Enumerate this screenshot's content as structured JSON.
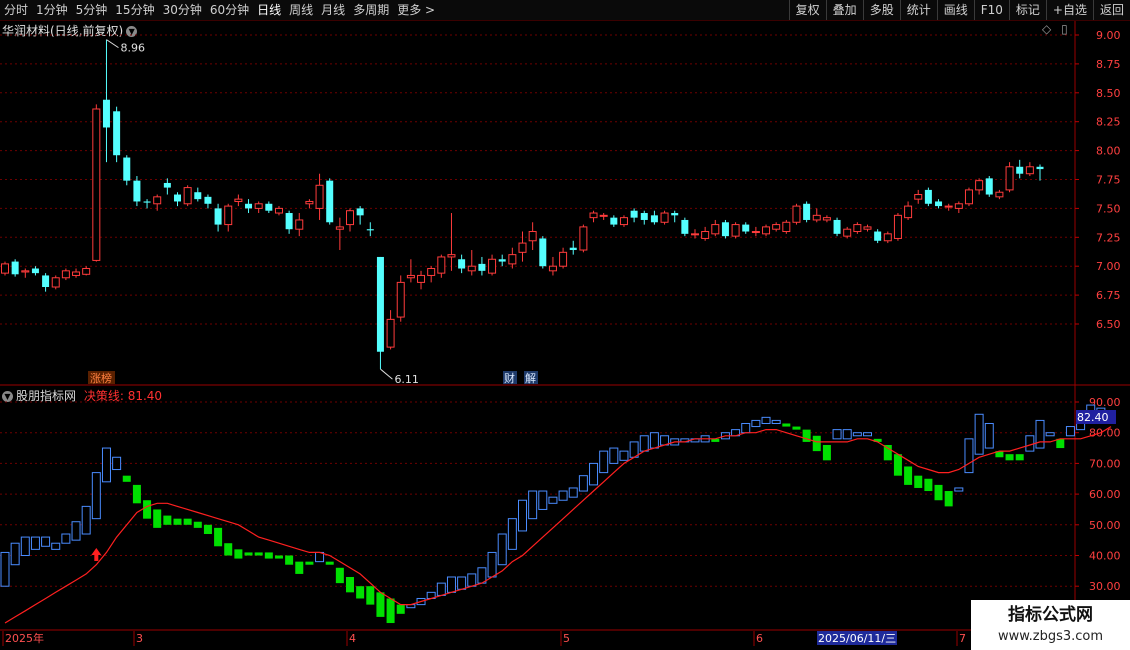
{
  "toolbar": {
    "left": [
      "分时",
      "1分钟",
      "5分钟",
      "15分钟",
      "30分钟",
      "60分钟",
      "日线",
      "周线",
      "月线",
      "多周期",
      "更多 >"
    ],
    "active_index": 6,
    "right": [
      "复权",
      "叠加",
      "多股",
      "统计",
      "画线",
      "F10",
      "标记",
      "+自选",
      "返回"
    ]
  },
  "main_panel": {
    "title": "华润材料(日线,前复权)",
    "price_axis": [
      "9.00",
      "8.75",
      "8.50",
      "8.25",
      "8.00",
      "7.75",
      "7.50",
      "7.25",
      "7.00",
      "6.75",
      "6.50"
    ],
    "high_label": "8.96",
    "low_label": "6.11",
    "tag_zhangbang": "涨榜",
    "tag_cai": "财",
    "tag_jie": "解"
  },
  "indicator_panel": {
    "name": "股朋指标网",
    "line_label": "决策线: 81.40",
    "current_value": "82.40",
    "axis": [
      "90.00",
      "80.00",
      "70.00",
      "60.00",
      "50.00",
      "40.00",
      "30.00"
    ]
  },
  "date_axis": {
    "labels": [
      "2025年",
      "3",
      "4",
      "5",
      "6",
      "7"
    ],
    "cursor_date": "2025/06/11/三"
  },
  "watermark": {
    "line1": "指标公式网",
    "line2": "www.zbgs3.com"
  },
  "colors": {
    "up": "#ff3c3c",
    "down": "#54ffff",
    "grid": "#6e0000",
    "decision_line": "#ff2020",
    "ind_up": "#4a8cff",
    "ind_down": "#00e000"
  },
  "chart_data": [
    {
      "type": "candlestick",
      "y_range": [
        6.1,
        9.0
      ],
      "bars": [
        {
          "o": 6.94,
          "c": 7.02,
          "h": 7.04,
          "l": 6.92
        },
        {
          "o": 7.04,
          "c": 6.93,
          "h": 7.06,
          "l": 6.91
        },
        {
          "o": 6.95,
          "c": 6.96,
          "h": 6.98,
          "l": 6.9
        },
        {
          "o": 6.98,
          "c": 6.94,
          "h": 7.0,
          "l": 6.92
        },
        {
          "o": 6.92,
          "c": 6.82,
          "h": 6.94,
          "l": 6.78
        },
        {
          "o": 6.82,
          "c": 6.9,
          "h": 6.92,
          "l": 6.8
        },
        {
          "o": 6.9,
          "c": 6.96,
          "h": 6.98,
          "l": 6.88
        },
        {
          "o": 6.92,
          "c": 6.95,
          "h": 6.98,
          "l": 6.9
        },
        {
          "o": 6.93,
          "c": 6.98,
          "h": 7.0,
          "l": 6.92
        },
        {
          "o": 7.05,
          "c": 8.36,
          "h": 8.4,
          "l": 7.04
        },
        {
          "o": 8.44,
          "c": 8.2,
          "h": 8.96,
          "l": 7.9
        },
        {
          "o": 8.34,
          "c": 7.96,
          "h": 8.38,
          "l": 7.9
        },
        {
          "o": 7.94,
          "c": 7.74,
          "h": 7.96,
          "l": 7.7
        },
        {
          "o": 7.74,
          "c": 7.56,
          "h": 7.78,
          "l": 7.52
        },
        {
          "o": 7.56,
          "c": 7.55,
          "h": 7.58,
          "l": 7.5
        },
        {
          "o": 7.54,
          "c": 7.6,
          "h": 7.62,
          "l": 7.48
        },
        {
          "o": 7.72,
          "c": 7.68,
          "h": 7.76,
          "l": 7.62
        },
        {
          "o": 7.62,
          "c": 7.56,
          "h": 7.64,
          "l": 7.52
        },
        {
          "o": 7.54,
          "c": 7.68,
          "h": 7.7,
          "l": 7.52
        },
        {
          "o": 7.64,
          "c": 7.58,
          "h": 7.68,
          "l": 7.56
        },
        {
          "o": 7.6,
          "c": 7.54,
          "h": 7.62,
          "l": 7.5
        },
        {
          "o": 7.5,
          "c": 7.36,
          "h": 7.54,
          "l": 7.3
        },
        {
          "o": 7.36,
          "c": 7.52,
          "h": 7.54,
          "l": 7.3
        },
        {
          "o": 7.56,
          "c": 7.58,
          "h": 7.62,
          "l": 7.52
        },
        {
          "o": 7.54,
          "c": 7.5,
          "h": 7.58,
          "l": 7.46
        },
        {
          "o": 7.5,
          "c": 7.54,
          "h": 7.56,
          "l": 7.46
        },
        {
          "o": 7.54,
          "c": 7.48,
          "h": 7.56,
          "l": 7.46
        },
        {
          "o": 7.46,
          "c": 7.5,
          "h": 7.52,
          "l": 7.44
        },
        {
          "o": 7.46,
          "c": 7.32,
          "h": 7.48,
          "l": 7.28
        },
        {
          "o": 7.32,
          "c": 7.4,
          "h": 7.46,
          "l": 7.26
        },
        {
          "o": 7.54,
          "c": 7.56,
          "h": 7.58,
          "l": 7.5
        },
        {
          "o": 7.5,
          "c": 7.7,
          "h": 7.8,
          "l": 7.4
        },
        {
          "o": 7.74,
          "c": 7.38,
          "h": 7.76,
          "l": 7.36
        },
        {
          "o": 7.32,
          "c": 7.34,
          "h": 7.42,
          "l": 7.14
        },
        {
          "o": 7.36,
          "c": 7.48,
          "h": 7.5,
          "l": 7.3
        },
        {
          "o": 7.5,
          "c": 7.44,
          "h": 7.52,
          "l": 7.36
        },
        {
          "o": 7.32,
          "c": 7.31,
          "h": 7.38,
          "l": 7.26
        },
        {
          "o": 7.08,
          "c": 6.26,
          "h": 7.08,
          "l": 6.11
        },
        {
          "o": 6.3,
          "c": 6.54,
          "h": 6.62,
          "l": 6.28
        },
        {
          "o": 6.56,
          "c": 6.86,
          "h": 6.92,
          "l": 6.52
        },
        {
          "o": 6.9,
          "c": 6.92,
          "h": 7.06,
          "l": 6.86
        },
        {
          "o": 6.86,
          "c": 6.92,
          "h": 6.96,
          "l": 6.8
        },
        {
          "o": 6.92,
          "c": 6.98,
          "h": 7.0,
          "l": 6.86
        },
        {
          "o": 6.94,
          "c": 7.08,
          "h": 7.1,
          "l": 6.9
        },
        {
          "o": 7.08,
          "c": 7.1,
          "h": 7.46,
          "l": 6.96
        },
        {
          "o": 7.06,
          "c": 6.98,
          "h": 7.1,
          "l": 6.94
        },
        {
          "o": 6.96,
          "c": 7.0,
          "h": 7.14,
          "l": 6.92
        },
        {
          "o": 7.02,
          "c": 6.96,
          "h": 7.08,
          "l": 6.92
        },
        {
          "o": 6.94,
          "c": 7.06,
          "h": 7.1,
          "l": 6.92
        },
        {
          "o": 7.06,
          "c": 7.04,
          "h": 7.1,
          "l": 7.0
        },
        {
          "o": 7.02,
          "c": 7.1,
          "h": 7.16,
          "l": 6.98
        },
        {
          "o": 7.12,
          "c": 7.2,
          "h": 7.3,
          "l": 7.04
        },
        {
          "o": 7.22,
          "c": 7.3,
          "h": 7.38,
          "l": 7.14
        },
        {
          "o": 7.24,
          "c": 7.0,
          "h": 7.26,
          "l": 6.98
        },
        {
          "o": 6.96,
          "c": 7.0,
          "h": 7.08,
          "l": 6.92
        },
        {
          "o": 7.0,
          "c": 7.12,
          "h": 7.16,
          "l": 6.98
        },
        {
          "o": 7.16,
          "c": 7.14,
          "h": 7.22,
          "l": 7.1
        },
        {
          "o": 7.14,
          "c": 7.34,
          "h": 7.36,
          "l": 7.12
        },
        {
          "o": 7.42,
          "c": 7.46,
          "h": 7.48,
          "l": 7.38
        },
        {
          "o": 7.44,
          "c": 7.44,
          "h": 7.46,
          "l": 7.4
        },
        {
          "o": 7.42,
          "c": 7.36,
          "h": 7.44,
          "l": 7.34
        },
        {
          "o": 7.36,
          "c": 7.42,
          "h": 7.44,
          "l": 7.34
        },
        {
          "o": 7.48,
          "c": 7.42,
          "h": 7.5,
          "l": 7.38
        },
        {
          "o": 7.46,
          "c": 7.4,
          "h": 7.48,
          "l": 7.36
        },
        {
          "o": 7.44,
          "c": 7.38,
          "h": 7.48,
          "l": 7.36
        },
        {
          "o": 7.38,
          "c": 7.46,
          "h": 7.48,
          "l": 7.36
        },
        {
          "o": 7.46,
          "c": 7.44,
          "h": 7.48,
          "l": 7.38
        },
        {
          "o": 7.4,
          "c": 7.28,
          "h": 7.42,
          "l": 7.26
        },
        {
          "o": 7.28,
          "c": 7.28,
          "h": 7.32,
          "l": 7.24
        },
        {
          "o": 7.24,
          "c": 7.3,
          "h": 7.34,
          "l": 7.22
        },
        {
          "o": 7.28,
          "c": 7.36,
          "h": 7.4,
          "l": 7.26
        },
        {
          "o": 7.38,
          "c": 7.26,
          "h": 7.4,
          "l": 7.24
        },
        {
          "o": 7.26,
          "c": 7.36,
          "h": 7.38,
          "l": 7.24
        },
        {
          "o": 7.36,
          "c": 7.3,
          "h": 7.38,
          "l": 7.28
        },
        {
          "o": 7.3,
          "c": 7.3,
          "h": 7.34,
          "l": 7.26
        },
        {
          "o": 7.28,
          "c": 7.34,
          "h": 7.36,
          "l": 7.26
        },
        {
          "o": 7.32,
          "c": 7.36,
          "h": 7.38,
          "l": 7.3
        },
        {
          "o": 7.3,
          "c": 7.38,
          "h": 7.4,
          "l": 7.28
        },
        {
          "o": 7.38,
          "c": 7.52,
          "h": 7.54,
          "l": 7.36
        },
        {
          "o": 7.54,
          "c": 7.4,
          "h": 7.56,
          "l": 7.38
        },
        {
          "o": 7.4,
          "c": 7.44,
          "h": 7.5,
          "l": 7.38
        },
        {
          "o": 7.4,
          "c": 7.42,
          "h": 7.44,
          "l": 7.38
        },
        {
          "o": 7.4,
          "c": 7.28,
          "h": 7.42,
          "l": 7.26
        },
        {
          "o": 7.26,
          "c": 7.32,
          "h": 7.34,
          "l": 7.24
        },
        {
          "o": 7.3,
          "c": 7.36,
          "h": 7.38,
          "l": 7.28
        },
        {
          "o": 7.32,
          "c": 7.34,
          "h": 7.36,
          "l": 7.3
        },
        {
          "o": 7.3,
          "c": 7.22,
          "h": 7.32,
          "l": 7.2
        },
        {
          "o": 7.22,
          "c": 7.28,
          "h": 7.3,
          "l": 7.2
        },
        {
          "o": 7.24,
          "c": 7.44,
          "h": 7.46,
          "l": 7.22
        },
        {
          "o": 7.42,
          "c": 7.52,
          "h": 7.56,
          "l": 7.4
        },
        {
          "o": 7.58,
          "c": 7.62,
          "h": 7.66,
          "l": 7.54
        },
        {
          "o": 7.66,
          "c": 7.54,
          "h": 7.68,
          "l": 7.52
        },
        {
          "o": 7.56,
          "c": 7.52,
          "h": 7.58,
          "l": 7.5
        },
        {
          "o": 7.52,
          "c": 7.52,
          "h": 7.54,
          "l": 7.48
        },
        {
          "o": 7.5,
          "c": 7.54,
          "h": 7.56,
          "l": 7.46
        },
        {
          "o": 7.54,
          "c": 7.66,
          "h": 7.68,
          "l": 7.52
        },
        {
          "o": 7.66,
          "c": 7.74,
          "h": 7.76,
          "l": 7.62
        },
        {
          "o": 7.76,
          "c": 7.62,
          "h": 7.78,
          "l": 7.6
        },
        {
          "o": 7.6,
          "c": 7.64,
          "h": 7.66,
          "l": 7.58
        },
        {
          "o": 7.66,
          "c": 7.86,
          "h": 7.9,
          "l": 7.64
        },
        {
          "o": 7.86,
          "c": 7.8,
          "h": 7.92,
          "l": 7.76
        },
        {
          "o": 7.8,
          "c": 7.86,
          "h": 7.9,
          "l": 7.78
        },
        {
          "o": 7.86,
          "c": 7.84,
          "h": 7.88,
          "l": 7.74
        }
      ]
    },
    {
      "type": "indicator",
      "y_range": [
        25,
        93
      ],
      "bars": [
        {
          "o": 30,
          "c": 41
        },
        {
          "o": 37,
          "c": 44
        },
        {
          "o": 40,
          "c": 46
        },
        {
          "o": 42,
          "c": 46
        },
        {
          "o": 43,
          "c": 46
        },
        {
          "o": 42,
          "c": 44
        },
        {
          "o": 44,
          "c": 47
        },
        {
          "o": 45,
          "c": 51
        },
        {
          "o": 47,
          "c": 56
        },
        {
          "o": 52,
          "c": 67
        },
        {
          "o": 64,
          "c": 75
        },
        {
          "o": 68,
          "c": 72
        },
        {
          "o": 66,
          "c": 64
        },
        {
          "o": 63,
          "c": 57
        },
        {
          "o": 58,
          "c": 52
        },
        {
          "o": 55,
          "c": 49
        },
        {
          "o": 53,
          "c": 50
        },
        {
          "o": 52,
          "c": 50
        },
        {
          "o": 52,
          "c": 50
        },
        {
          "o": 51,
          "c": 49
        },
        {
          "o": 50,
          "c": 47
        },
        {
          "o": 49,
          "c": 43
        },
        {
          "o": 44,
          "c": 40
        },
        {
          "o": 42,
          "c": 39
        },
        {
          "o": 41,
          "c": 40
        },
        {
          "o": 41,
          "c": 40
        },
        {
          "o": 41,
          "c": 39
        },
        {
          "o": 40,
          "c": 39
        },
        {
          "o": 40,
          "c": 37
        },
        {
          "o": 38,
          "c": 34
        },
        {
          "o": 38,
          "c": 37
        },
        {
          "o": 38,
          "c": 41
        },
        {
          "o": 38,
          "c": 37
        },
        {
          "o": 36,
          "c": 31
        },
        {
          "o": 33,
          "c": 28
        },
        {
          "o": 30,
          "c": 26
        },
        {
          "o": 30,
          "c": 24
        },
        {
          "o": 28,
          "c": 20
        },
        {
          "o": 26,
          "c": 18
        },
        {
          "o": 24,
          "c": 21
        },
        {
          "o": 23,
          "c": 24
        },
        {
          "o": 24,
          "c": 26
        },
        {
          "o": 26,
          "c": 28
        },
        {
          "o": 27,
          "c": 31
        },
        {
          "o": 28,
          "c": 33
        },
        {
          "o": 29,
          "c": 33
        },
        {
          "o": 30,
          "c": 34
        },
        {
          "o": 31,
          "c": 36
        },
        {
          "o": 33,
          "c": 41
        },
        {
          "o": 37,
          "c": 47
        },
        {
          "o": 42,
          "c": 52
        },
        {
          "o": 48,
          "c": 58
        },
        {
          "o": 52,
          "c": 61
        },
        {
          "o": 55,
          "c": 61
        },
        {
          "o": 57,
          "c": 59
        },
        {
          "o": 58,
          "c": 61
        },
        {
          "o": 59,
          "c": 62
        },
        {
          "o": 61,
          "c": 66
        },
        {
          "o": 63,
          "c": 70
        },
        {
          "o": 67,
          "c": 74
        },
        {
          "o": 70,
          "c": 75
        },
        {
          "o": 71,
          "c": 74
        },
        {
          "o": 72,
          "c": 77
        },
        {
          "o": 74,
          "c": 79
        },
        {
          "o": 75,
          "c": 80
        },
        {
          "o": 76,
          "c": 79
        },
        {
          "o": 76,
          "c": 78
        },
        {
          "o": 77,
          "c": 78
        },
        {
          "o": 77,
          "c": 78
        },
        {
          "o": 77,
          "c": 79
        },
        {
          "o": 78,
          "c": 77
        },
        {
          "o": 78,
          "c": 80
        },
        {
          "o": 79,
          "c": 81
        },
        {
          "o": 80,
          "c": 83
        },
        {
          "o": 82,
          "c": 84
        },
        {
          "o": 83,
          "c": 85
        },
        {
          "o": 83,
          "c": 84
        },
        {
          "o": 83,
          "c": 82
        },
        {
          "o": 82,
          "c": 81
        },
        {
          "o": 81,
          "c": 77
        },
        {
          "o": 79,
          "c": 74
        },
        {
          "o": 76,
          "c": 71
        },
        {
          "o": 78,
          "c": 81
        },
        {
          "o": 78,
          "c": 81
        },
        {
          "o": 79,
          "c": 80
        },
        {
          "o": 79,
          "c": 80
        },
        {
          "o": 78,
          "c": 77
        },
        {
          "o": 76,
          "c": 71
        },
        {
          "o": 73,
          "c": 66
        },
        {
          "o": 69,
          "c": 63
        },
        {
          "o": 66,
          "c": 62
        },
        {
          "o": 65,
          "c": 61
        },
        {
          "o": 63,
          "c": 58
        },
        {
          "o": 61,
          "c": 56
        },
        {
          "o": 61,
          "c": 62
        },
        {
          "o": 67,
          "c": 78
        },
        {
          "o": 73,
          "c": 86
        },
        {
          "o": 75,
          "c": 83
        },
        {
          "o": 74,
          "c": 72
        },
        {
          "o": 73,
          "c": 71
        },
        {
          "o": 73,
          "c": 71
        },
        {
          "o": 74,
          "c": 79
        },
        {
          "o": 75,
          "c": 84
        },
        {
          "o": 79,
          "c": 80
        },
        {
          "o": 78,
          "c": 75
        },
        {
          "o": 79,
          "c": 82
        },
        {
          "o": 81,
          "c": 86
        },
        {
          "o": 84,
          "c": 89
        },
        {
          "o": 86,
          "c": 88
        }
      ],
      "decision_line": [
        18,
        20,
        22,
        24,
        26,
        28,
        30,
        32,
        34,
        37,
        41,
        46,
        50,
        54,
        56,
        57,
        57,
        56,
        55,
        54,
        53,
        52,
        51,
        50,
        48,
        46,
        45,
        44,
        43,
        42,
        41,
        41,
        40,
        38,
        36,
        34,
        31,
        28,
        26,
        24,
        24,
        25,
        26,
        27,
        28,
        29,
        30,
        31,
        33,
        35,
        38,
        40,
        43,
        46,
        49,
        52,
        55,
        58,
        61,
        64,
        67,
        70,
        72,
        74,
        75,
        76,
        77,
        77,
        78,
        78,
        78,
        79,
        79,
        80,
        80,
        81,
        81,
        80,
        79,
        78,
        77,
        77,
        77,
        77,
        78,
        78,
        77,
        75,
        73,
        71,
        69,
        68,
        67,
        67,
        68,
        70,
        72,
        73,
        74,
        74,
        75,
        76,
        77,
        77,
        78,
        78,
        78,
        79,
        80,
        82
      ]
    }
  ]
}
